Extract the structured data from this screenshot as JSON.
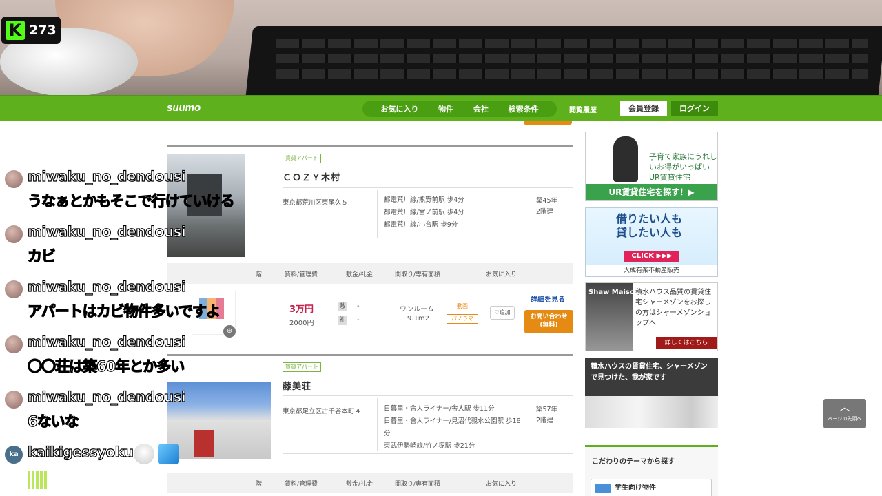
{
  "stream": {
    "viewer_count": "273",
    "logo_letter": "K"
  },
  "site": {
    "logo": "suumo",
    "nav": [
      "お気に入り",
      "物件",
      "会社",
      "検索条件"
    ],
    "history": "閲覧履歴",
    "register": "会員登録",
    "login": "ログイン"
  },
  "listings": [
    {
      "type": "賃貸アパート",
      "name": "ＣＯＺＹ木村",
      "address": "東京都荒川区東尾久５",
      "stations": [
        "都電荒川線/熊野前駅 歩4分",
        "都電荒川線/宮ノ前駅 歩4分",
        "都電荒川線/小台駅 歩9分"
      ],
      "age": "築45年",
      "floors": "2階建",
      "table_headers": [
        "階",
        "賃料/管理費",
        "敷金/礼金",
        "間取り/専有面積",
        "お気に入り"
      ],
      "room": {
        "rent": "3万円",
        "mgmt_fee": "2000円",
        "deposit_label": "敷",
        "deposit": "-",
        "key_money_label": "礼",
        "key_money": "-",
        "layout": "ワンルーム",
        "area": "9.1m2",
        "video": "動画",
        "panorama": "パノラマ",
        "favorite": "♡追加",
        "detail": "詳細を見る",
        "inquiry": "お問い合わせ",
        "inquiry_sub": "(無料)"
      }
    },
    {
      "type": "賃貸アパート",
      "name": "藤美荘",
      "address": "東京都足立区古千谷本町４",
      "stations": [
        "日暮里・舎人ライナー/舎人駅 歩11分",
        "日暮里・舎人ライナー/見沼代親水公園駅 歩18分",
        "東武伊勢崎線/竹ノ塚駅 歩21分"
      ],
      "age": "築57年",
      "floors": "2階建",
      "table_headers": [
        "階",
        "賃料/管理費",
        "敷金/礼金",
        "間取り/専有面積",
        "お気に入り"
      ]
    }
  ],
  "sidebar": {
    "ad1": {
      "text": "子育て家族にうれしいお得がいっぱい UR賃貸住宅",
      "bar": "UR賃貸住宅を探す！▶"
    },
    "ad2": {
      "text1": "借りたい人も",
      "text2": "貸したい人も",
      "click": "CLICK ▶▶▶",
      "company": "大成有楽不動産販売"
    },
    "ad3": {
      "brand": "Shaw Maison",
      "text": "積水ハウス品質の賃貸住宅シャーメゾンをお探しの方はシャーメゾンショップへ",
      "button": "詳しくはこちら"
    },
    "ad4": {
      "text": "積水ハウスの賃貸住宅、シャーメゾンで見つけた、我が家です"
    },
    "theme_title": "こだわりのテーマから探す",
    "theme_item": "学生向け物件"
  },
  "to_top": "ページの先頭へ",
  "chat": [
    {
      "user": "miwaku_no_dendousi",
      "text": "うなぁとかもそこで行けていける"
    },
    {
      "user": "miwaku_no_dendousi",
      "text": "カビ"
    },
    {
      "user": "miwaku_no_dendousi",
      "text": "アパートはカビ物件多いですよ"
    },
    {
      "user": "miwaku_no_dendousi",
      "text": "〇〇荘は築60年とか多い"
    },
    {
      "user": "miwaku_no_dendousi",
      "text": "6ないな"
    },
    {
      "user": "kaikigessyoku",
      "avatar_text": "ka",
      "text": ""
    }
  ]
}
